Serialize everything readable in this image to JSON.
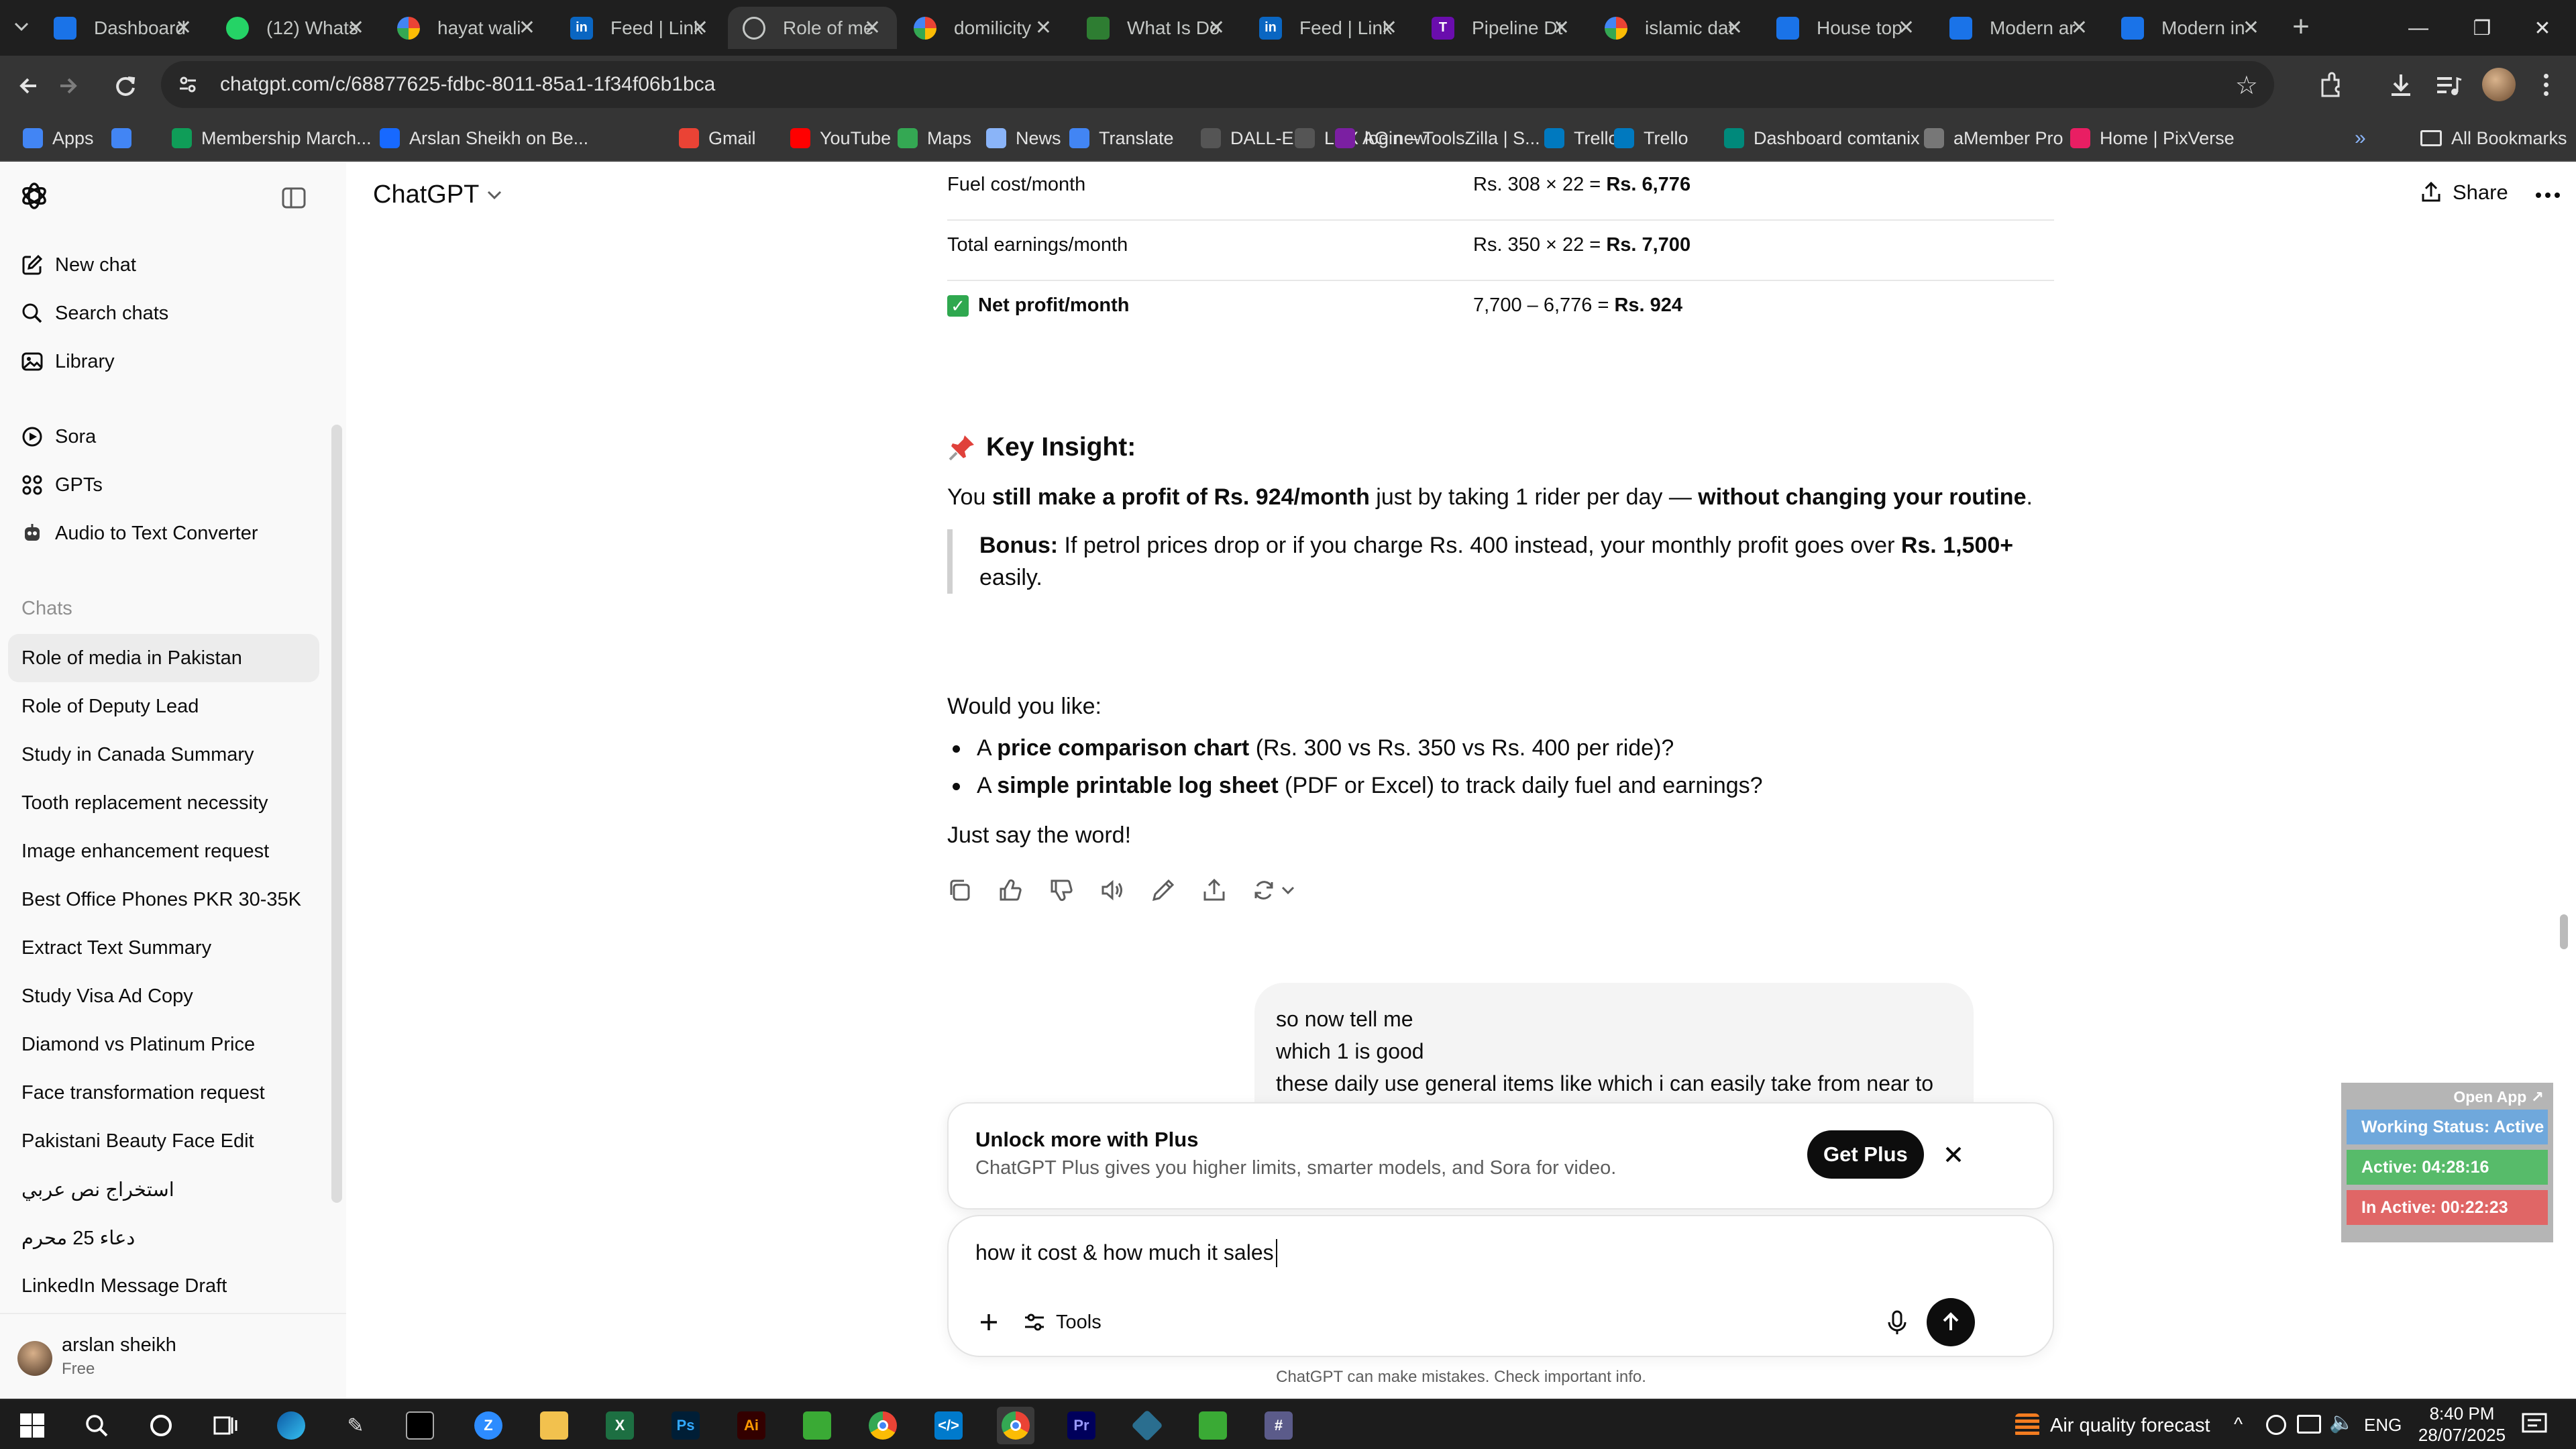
{
  "browser": {
    "tabs": [
      {
        "title": "Dashboard",
        "color": "#1a73e8",
        "icon": "gauge-icon"
      },
      {
        "title": "(12) Whats",
        "color": "#25d366",
        "icon": "whatsapp-icon"
      },
      {
        "title": "hayat wali",
        "color": "#ffffff",
        "icon": "google-icon"
      },
      {
        "title": "Feed | Link",
        "color": "#0a66c2",
        "icon": "linkedin-icon"
      },
      {
        "title": "Role of me",
        "color": "#444444",
        "icon": "chatgpt-icon",
        "active": true
      },
      {
        "title": "domilicity",
        "color": "#ffffff",
        "icon": "google-icon"
      },
      {
        "title": "What Is Do",
        "color": "#2e7d32",
        "icon": "leaf-icon"
      },
      {
        "title": "Feed | Link",
        "color": "#0a66c2",
        "icon": "linkedin-icon"
      },
      {
        "title": "Pipeline Dt",
        "color": "#6a0dad",
        "icon": "t-icon"
      },
      {
        "title": "islamic dat",
        "color": "#ffffff",
        "icon": "google-icon"
      },
      {
        "title": "House top",
        "color": "#1a73e8",
        "icon": "doc-icon"
      },
      {
        "title": "Modern ar",
        "color": "#1a73e8",
        "icon": "doc-icon"
      },
      {
        "title": "Modern in",
        "color": "#1a73e8",
        "icon": "doc-icon"
      }
    ],
    "url": "chatgpt.com/c/68877625-fdbc-8011-85a1-1f34f06b1bca",
    "bookmarks": [
      {
        "label": "Apps",
        "color": "#4285f4"
      },
      {
        "label": "",
        "color": "#4285f4"
      },
      {
        "label": "Membership March...",
        "color": "#0f9d58"
      },
      {
        "label": "Arslan Sheikh on Be...",
        "color": "#1769ff"
      },
      {
        "label": "Gmail",
        "color": "#ea4335"
      },
      {
        "label": "YouTube",
        "color": "#ff0000"
      },
      {
        "label": "Maps",
        "color": "#34a853"
      },
      {
        "label": "News",
        "color": "#8ab4f8"
      },
      {
        "label": "Translate",
        "color": "#4285f4"
      },
      {
        "label": "DALL-E 2",
        "color": "#555555"
      },
      {
        "label": "LPX AG new",
        "color": "#555555"
      },
      {
        "label": "login – ToolsZilla | S...",
        "color": "#7b1fa2"
      },
      {
        "label": "Trello",
        "color": "#0079bf"
      },
      {
        "label": "Trello",
        "color": "#0079bf"
      },
      {
        "label": "Dashboard comtanix",
        "color": "#00897b"
      },
      {
        "label": "aMember Pro",
        "color": "#777777"
      },
      {
        "label": "Home | PixVerse",
        "color": "#e91e63"
      }
    ],
    "all_bookmarks": "All Bookmarks"
  },
  "sidebar": {
    "new_chat": "New chat",
    "search_chats": "Search chats",
    "library": "Library",
    "sora": "Sora",
    "gpts": "GPTs",
    "audio_converter": "Audio to Text Converter",
    "chats_heading": "Chats",
    "chats": [
      "Role of media in Pakistan",
      "Role of Deputy Lead",
      "Study in Canada Summary",
      "Tooth replacement necessity",
      "Image enhancement request",
      "Best Office Phones PKR 30-35K",
      "Extract Text Summary",
      "Study Visa Ad Copy",
      "Diamond vs Platinum Price",
      "Face transformation request",
      "Pakistani Beauty Face Edit",
      "استخراج نص عربي",
      "دعاء 25 محرم",
      "LinkedIn Message Draft"
    ],
    "user_name": "arslan sheikh",
    "user_plan": "Free"
  },
  "header": {
    "model": "ChatGPT",
    "share": "Share"
  },
  "table": [
    {
      "label": "Fuel cost/month",
      "calc": "Rs. 308 × 22 = ",
      "result": "Rs. 6,776"
    },
    {
      "label": "Total earnings/month",
      "calc": "Rs. 350 × 22 = ",
      "result": "Rs. 7,700"
    },
    {
      "label": "Net profit/month",
      "calc": "7,700 – 6,776 = ",
      "result": "Rs. 924"
    }
  ],
  "insight": {
    "heading": "Key Insight:",
    "p1": "You ",
    "p1_b1": "still make a profit of Rs. 924/month",
    "p1_m": " just by taking 1 rider per day — ",
    "p1_b2": "without changing your routine",
    "p1_end": ".",
    "bonus_label": "Bonus:",
    "bonus_text": " If petrol prices drop or if you charge Rs. 400 instead, your monthly profit goes over ",
    "bonus_b": "Rs. 1,500+",
    "bonus_end": "easily."
  },
  "followup": {
    "intro": "Would you like:",
    "item1_pre": "A ",
    "item1_b": "price comparison chart",
    "item1_post": " (Rs. 300 vs Rs. 350 vs Rs. 400 per ride)?",
    "item2_pre": "A ",
    "item2_b": "simple printable log sheet",
    "item2_post": " (PDF or Excel) to track daily fuel and earnings?",
    "closing": "Just say the word!"
  },
  "user_message": [
    "so now tell me",
    "which 1 is good",
    "these daily use general items like which i can easily take from near to"
  ],
  "plus_banner": {
    "title": "Unlock more with Plus",
    "subtitle": "ChatGPT Plus gives you higher limits, smarter models, and Sora for video.",
    "button": "Get Plus"
  },
  "composer": {
    "value": "how it cost & how much it sales",
    "tools": "Tools"
  },
  "disclaimer": "ChatGPT can make mistakes. Check important info.",
  "widget": {
    "open_app": "Open App ↗",
    "status": "Working Status: Active",
    "active": "Active: 04:28:16",
    "inactive": "In Active: 00:22:23",
    "status_color": "#6fa8dc",
    "active_color": "#57bb6a",
    "inactive_color": "#e06666"
  },
  "taskbar": {
    "weather": "Air quality forecast",
    "lang": "ENG",
    "time": "8:40 PM",
    "date": "28/07/2025"
  }
}
